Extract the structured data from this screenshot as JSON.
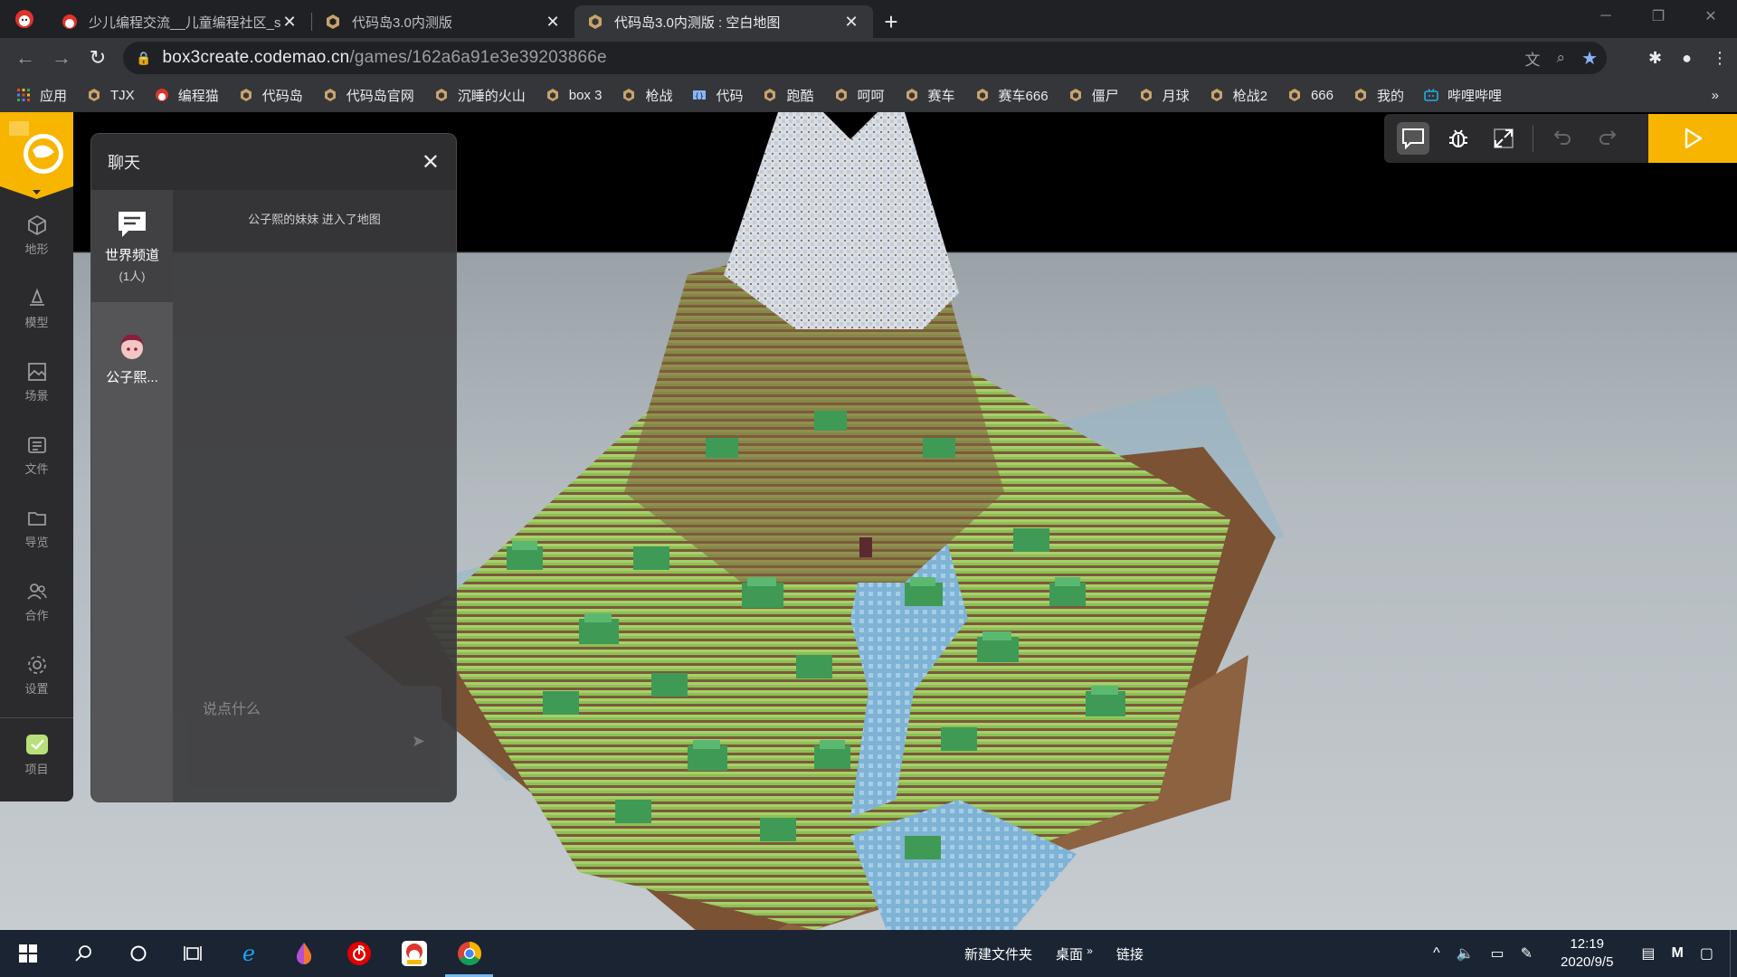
{
  "browser": {
    "tabs": [
      {
        "title": "少儿编程交流__儿童编程社区_sc",
        "active": false
      },
      {
        "title": "代码岛3.0内测版",
        "active": false
      },
      {
        "title": "代码岛3.0内测版 : 空白地图",
        "active": true
      }
    ],
    "url_host": "box3create.codemao.cn",
    "url_path": "/games/162a6a91e3e39203866e",
    "bookmarks": [
      "应用",
      "TJX",
      "编程猫",
      "代码岛",
      "代码岛官网",
      "沉睡的火山",
      "box 3",
      "枪战",
      "代码",
      "跑酷",
      "呵呵",
      "赛车",
      "赛车666",
      "僵尸",
      "月球",
      "枪战2",
      "666",
      "我的",
      "哔哩哔哩"
    ],
    "bookmarks_more": "»"
  },
  "rail": {
    "items": [
      {
        "label": "地形",
        "icon": "cube-icon"
      },
      {
        "label": "模型",
        "icon": "bell-icon"
      },
      {
        "label": "场景",
        "icon": "image-icon"
      },
      {
        "label": "文件",
        "icon": "file-list-icon"
      },
      {
        "label": "导览",
        "icon": "folder-icon"
      },
      {
        "label": "合作",
        "icon": "users-icon"
      },
      {
        "label": "设置",
        "icon": "gear-icon"
      },
      {
        "label": "项目",
        "icon": "project-icon"
      }
    ]
  },
  "chat": {
    "title": "聊天",
    "close": "✕",
    "channels": [
      {
        "name": "世界频道",
        "sub": "(1人)"
      },
      {
        "name": "公子熙..."
      }
    ],
    "message": "公子熙的妹妹 进入了地图",
    "input_placeholder": "说点什么"
  },
  "colors": {
    "accent": "#f7b500",
    "rail_bg": "#2b2b2d",
    "taskbar_bg": "#1a2433"
  },
  "taskbar": {
    "toolbars": [
      "新建文件夹",
      "桌面",
      "链接"
    ],
    "chevron": "»",
    "time": "12:19",
    "date": "2020/9/5"
  }
}
